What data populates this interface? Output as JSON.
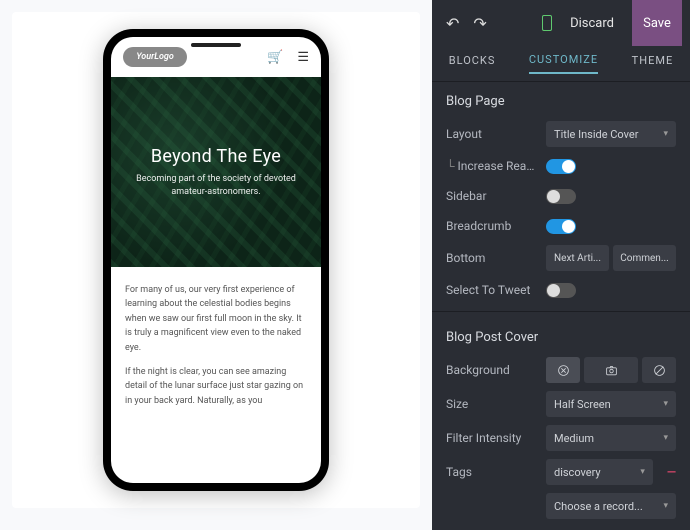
{
  "preview": {
    "logo_text": "YourLogo",
    "hero_title": "Beyond The Eye",
    "hero_subtitle": "Becoming part of the society of devoted amateur-astronomers.",
    "p1": "For many of us, our very first experience of learning about the celestial bodies begins when we saw our first full moon in the sky. It is truly a magnificent view even to the naked eye.",
    "p2": "If the night is clear, you can see amazing detail of the lunar surface just star gazing on in your back yard. Naturally, as you"
  },
  "panel": {
    "discard": "Discard",
    "save": "Save",
    "tabs": {
      "blocks": "BLOCKS",
      "customize": "CUSTOMIZE",
      "theme": "THEME"
    },
    "blog_page": {
      "title": "Blog Page",
      "layout_label": "Layout",
      "layout_value": "Title Inside Cover",
      "increase_label": "Increase Read...",
      "increase_on": true,
      "sidebar_label": "Sidebar",
      "sidebar_on": false,
      "breadcrumb_label": "Breadcrumb",
      "breadcrumb_on": true,
      "bottom_label": "Bottom",
      "bottom_opts": [
        "Next Arti...",
        "Commen..."
      ],
      "select_tweet_label": "Select To Tweet",
      "select_tweet_on": false
    },
    "cover": {
      "title": "Blog Post Cover",
      "bg_label": "Background",
      "size_label": "Size",
      "size_value": "Half Screen",
      "filter_label": "Filter Intensity",
      "filter_value": "Medium",
      "tags_label": "Tags",
      "tag_value": "discovery",
      "add_record": "Choose a record..."
    }
  }
}
